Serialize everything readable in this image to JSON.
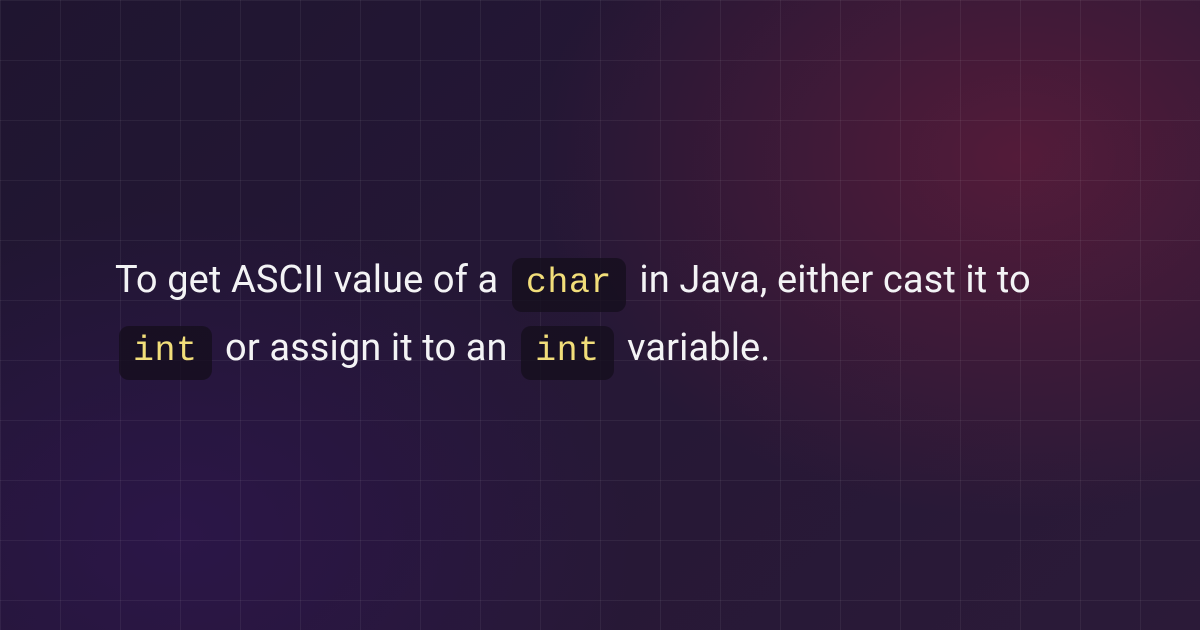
{
  "text": {
    "part1": "To get ASCII value of a ",
    "code1": "char",
    "part2": " in Java, either cast it to ",
    "code2": "int",
    "part3": " or assign it to an ",
    "code3": "int",
    "part4": " variable."
  },
  "colors": {
    "text": "#f3f3f5",
    "code_text": "#f2de7a",
    "code_bg": "rgba(20,14,28,0.78)"
  }
}
